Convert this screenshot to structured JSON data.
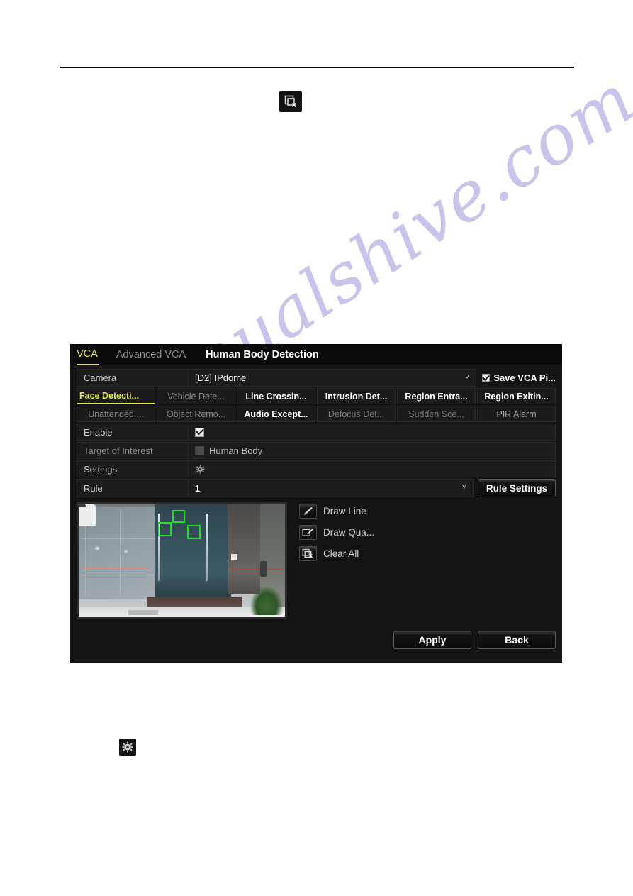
{
  "document": {
    "watermark_text": "manualshive.com",
    "inline_icons": [
      {
        "name": "clear-all-icon",
        "glyph": "rect-with-x"
      },
      {
        "name": "gear-icon",
        "glyph": "gear"
      }
    ]
  },
  "dialog": {
    "header_tabs": [
      {
        "label": "VCA",
        "state": "active"
      },
      {
        "label": "Advanced VCA",
        "state": "dim"
      },
      {
        "label": "Human Body Detection",
        "state": "bright"
      }
    ],
    "camera_row": {
      "label": "Camera",
      "value": "[D2] IPdome",
      "chevron": "˅",
      "save_vca_label": "Save VCA Pi...",
      "save_vca_checked": true
    },
    "detection_tabs": [
      {
        "label": "Face Detecti...",
        "state": "state-active"
      },
      {
        "label": "Vehicle Dete...",
        "state": "state-off"
      },
      {
        "label": "Line Crossin...",
        "state": "state-on"
      },
      {
        "label": "Intrusion Det...",
        "state": "state-on"
      },
      {
        "label": "Region Entra...",
        "state": "state-on"
      },
      {
        "label": "Region Exitin...",
        "state": "state-on"
      },
      {
        "label": "Unattended ...",
        "state": "state-off"
      },
      {
        "label": "Object Remo...",
        "state": "state-off"
      },
      {
        "label": "Audio Except...",
        "state": "state-on"
      },
      {
        "label": "Defocus Det...",
        "state": "state-dimmer"
      },
      {
        "label": "Sudden Sce...",
        "state": "state-dimmer"
      },
      {
        "label": "PIR Alarm",
        "state": "state-pir"
      }
    ],
    "rows": {
      "enable": {
        "label": "Enable",
        "checked": true
      },
      "target_of_interest": {
        "label": "Target of Interest",
        "option_label": "Human Body",
        "checked": false
      },
      "settings": {
        "label": "Settings",
        "icon": "gear-icon"
      },
      "rule": {
        "label": "Rule",
        "value": "1",
        "chevron": "˅",
        "button_label": "Rule Settings"
      }
    },
    "draw_tools": [
      {
        "label": "Draw Line",
        "icon": "pencil-icon"
      },
      {
        "label": "Draw Qua...",
        "icon": "draw-quadrilateral-icon"
      },
      {
        "label": "Clear All",
        "icon": "clear-all-icon"
      }
    ],
    "footer": {
      "apply_label": "Apply",
      "back_label": "Back"
    },
    "preview": {
      "name": "camera-preview",
      "face_boxes": 3
    }
  },
  "colors": {
    "accent_yellow": "#e8e83a",
    "panel_bg": "#141414",
    "row_bg": "#1c1c1c",
    "detection_box_green": "#21e021",
    "watermark_purple": "#564ebe"
  }
}
